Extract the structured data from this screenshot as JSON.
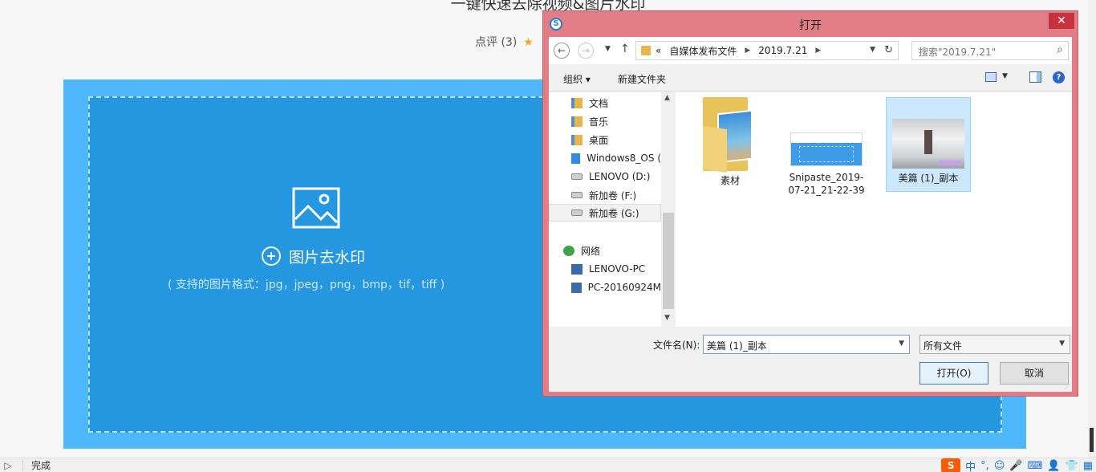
{
  "page": {
    "title": "一键快速去除视频&图片水印",
    "rating_label": "点评 (3)",
    "upload_button": "图片去水印",
    "upload_formats": "( 支持的图片格式：jpg，jpeg，png，bmp，tif，tiff )"
  },
  "statusbar": {
    "status_text": "完成",
    "tray": [
      "中",
      "°,",
      "☺",
      "🎤",
      "⌨",
      "👤",
      "👕",
      "▦"
    ]
  },
  "dialog": {
    "title": "打开",
    "close_glyph": "✕",
    "address": {
      "overflow": "«",
      "crumbs": [
        "自媒体发布文件",
        "2019.7.21"
      ],
      "search_placeholder": "搜索\"2019.7.21\""
    },
    "toolbar": {
      "organize": "组织 ▾",
      "new_folder": "新建文件夹",
      "help": "?"
    },
    "nav_items": [
      {
        "label": "文档",
        "icon": "documents-icon"
      },
      {
        "label": "音乐",
        "icon": "music-icon"
      },
      {
        "label": "桌面",
        "icon": "desktop-icon"
      },
      {
        "label": "Windows8_OS (",
        "icon": "windows-drive-icon"
      },
      {
        "label": "LENOVO (D:)",
        "icon": "drive-icon"
      },
      {
        "label": "新加卷 (F:)",
        "icon": "drive-icon"
      },
      {
        "label": "新加卷 (G:)",
        "icon": "drive-icon"
      },
      {
        "label": "网络",
        "icon": "network-icon"
      },
      {
        "label": "LENOVO-PC",
        "icon": "computer-icon"
      },
      {
        "label": "PC-20160924M",
        "icon": "computer-icon"
      }
    ],
    "files": [
      {
        "name": "素材",
        "type": "folder"
      },
      {
        "name": "Snipaste_2019-07-21_21-22-39",
        "line1": "Snipaste_2019-",
        "line2": "07-21_21-22-39",
        "type": "image"
      },
      {
        "name": "美篇 (1)_副本",
        "type": "image",
        "selected": true
      }
    ],
    "filename_label": "文件名(N):",
    "filename_value": "美篇 (1)_副本",
    "filetype_value": "所有文件",
    "open_button": "打开(O)",
    "cancel_button": "取消"
  }
}
